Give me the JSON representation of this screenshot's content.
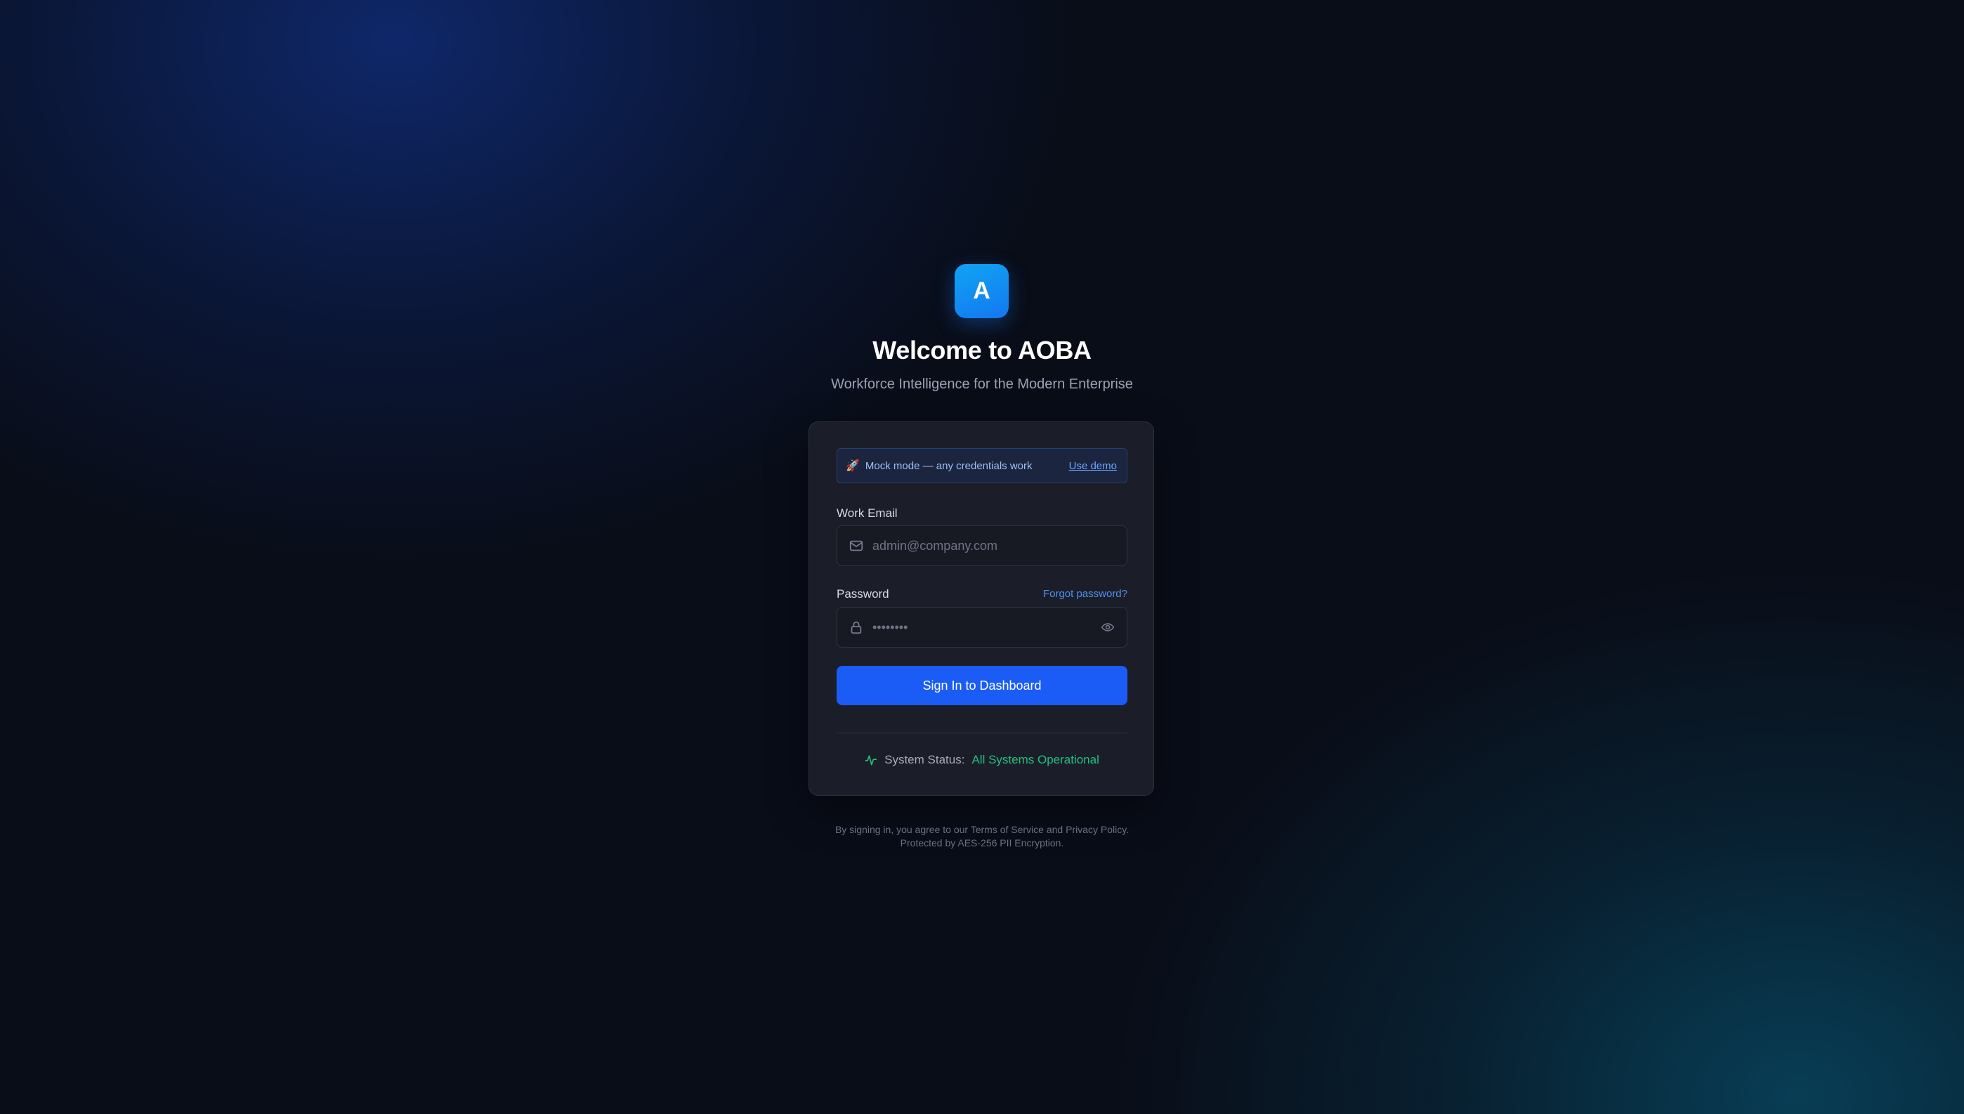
{
  "brand": {
    "logo_letter": "A",
    "title": "Welcome to AOBA",
    "subtitle": "Workforce Intelligence for the Modern Enterprise",
    "accent_color": "#1a5cf5",
    "logo_gradient": [
      "#10a4f4",
      "#1378f0"
    ]
  },
  "mock_banner": {
    "icon": "rocket-emoji",
    "text": "Mock mode — any credentials work",
    "link_label": "Use demo"
  },
  "form": {
    "email": {
      "label": "Work Email",
      "placeholder": "admin@company.com",
      "value": "",
      "icon": "mail-icon"
    },
    "password": {
      "label": "Password",
      "placeholder": "••••••••",
      "value": "",
      "icon": "lock-icon",
      "toggle_icon": "eye-icon",
      "forgot_label": "Forgot password?"
    },
    "submit_label": "Sign In to Dashboard"
  },
  "status": {
    "icon": "activity-icon",
    "label": "System Status:",
    "value": "All Systems Operational",
    "color": "#23c17e"
  },
  "footer": {
    "line1": "By signing in, you agree to our Terms of Service and Privacy Policy.",
    "line2": "Protected by AES-256 PII Encryption."
  }
}
